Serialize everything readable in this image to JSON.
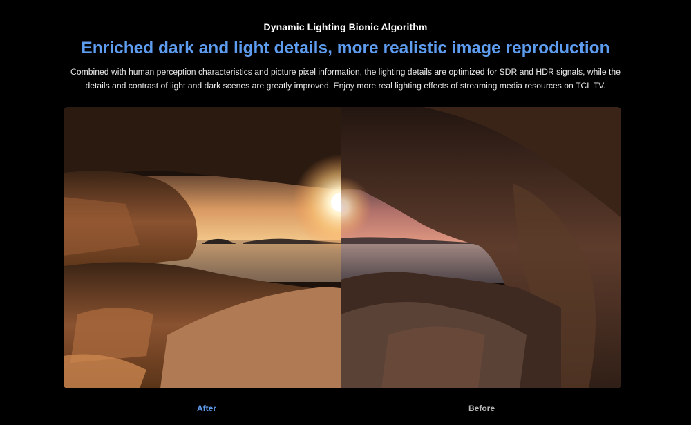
{
  "section": {
    "eyebrow": "Dynamic Lighting Bionic Algorithm",
    "headline": "Enriched dark and light details, more realistic image reproduction",
    "description": "Combined with human perception characteristics and picture pixel information, the lighting details are optimized for SDR and HDR signals, while the details and contrast of light and dark scenes are greatly improved. Enjoy more real lighting effects of streaming media resources on TCL TV."
  },
  "comparison": {
    "after_label": "After",
    "before_label": "Before",
    "colors": {
      "after_label": "#5e9cf0",
      "before_label": "#b8b8b8",
      "headline": "#5e9cf0"
    }
  }
}
